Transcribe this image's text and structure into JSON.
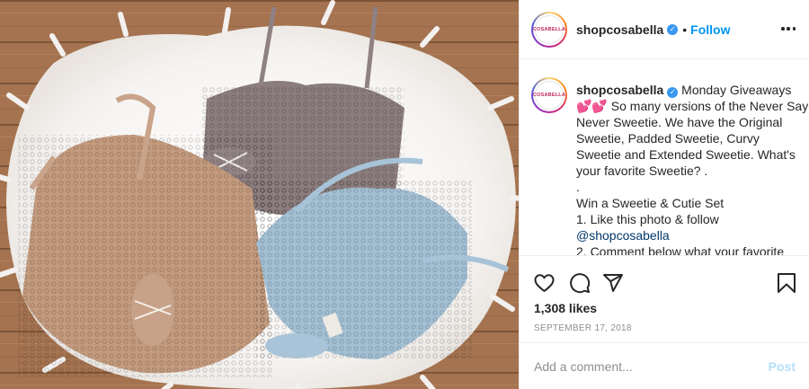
{
  "post": {
    "image_alt": "Three lace bralettes in taupe, grey and light blue on a white fur rug on a wooden floor",
    "avatar_text": "COSABELLA"
  },
  "header": {
    "username": "shopcosabella",
    "verified_glyph": "✓",
    "separator": "•",
    "follow_label": "Follow",
    "more_icon": "more-horizontal-icon"
  },
  "caption": {
    "username": "shopcosabella",
    "verified_glyph": "✓",
    "first_line": "Monday Giveaways",
    "hearts": "💕💕",
    "line2": "So many versions of the Never Say",
    "line3": "Never Sweetie. We have the Original",
    "line4": "Sweetie, Padded Sweetie, Curvy",
    "line5": "Sweetie and Extended Sweetie. What's",
    "line6": "your favorite Sweetie? .",
    "line7": ".",
    "line8": "Win a Sweetie & Cutie Set",
    "line9": "1. Like this photo & follow",
    "mention": "@shopcosabella",
    "line11": "2. Comment below what your favorite"
  },
  "actions": {
    "icons": [
      "heart-icon",
      "comment-icon",
      "share-icon",
      "bookmark-icon"
    ],
    "likes": "1,308 likes",
    "date": "SEPTEMBER 17, 2018"
  },
  "composer": {
    "placeholder": "Add a comment...",
    "post_label": "Post"
  },
  "colors": {
    "accent": "#0095f6",
    "verified": "#3897f0",
    "muted": "#8e8e8e",
    "post_disabled": "#b2dffc"
  }
}
